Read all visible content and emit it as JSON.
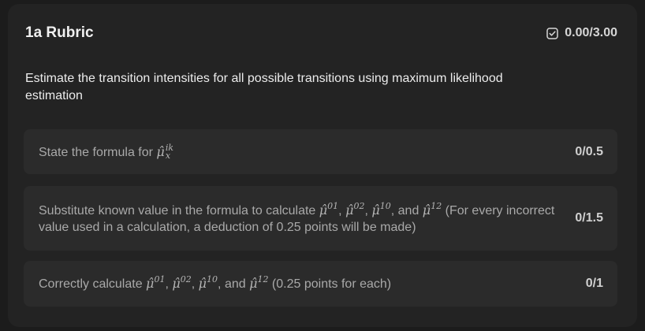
{
  "header": {
    "title": "1a Rubric",
    "score": "0.00/3.00",
    "icon": "checkbox-icon"
  },
  "description": "Estimate the transition intensities for all possible transitions using maximum likelihood estimation",
  "items": [
    {
      "text_before": "State the formula for ",
      "math": {
        "base": "μ̂",
        "sup": "ik",
        "sub": "x"
      },
      "points": "0/0.5"
    },
    {
      "text_before": "Substitute known value in the formula to calculate ",
      "math_list": [
        {
          "base": "μ̂",
          "sup": "01",
          "after": ", "
        },
        {
          "base": "μ̂",
          "sup": "02",
          "after": ", "
        },
        {
          "base": "μ̂",
          "sup": "10",
          "after": ", and "
        },
        {
          "base": "μ̂",
          "sup": "12",
          "after": ""
        }
      ],
      "text_after": " (For every incorrect value used in a calculation, a deduction of 0.25 points will be made)",
      "points": "0/1.5"
    },
    {
      "text_before": "Correctly calculate ",
      "math_list": [
        {
          "base": "μ̂",
          "sup": "01",
          "after": ", "
        },
        {
          "base": "μ̂",
          "sup": "02",
          "after": ", "
        },
        {
          "base": "μ̂",
          "sup": "10",
          "after": ", and "
        },
        {
          "base": "μ̂",
          "sup": "12",
          "after": ""
        }
      ],
      "text_after": " (0.25 points for each)",
      "points": "0/1"
    }
  ],
  "colors": {
    "background": "#1c1c1c",
    "card": "#232323",
    "item": "#2b2b2b"
  }
}
